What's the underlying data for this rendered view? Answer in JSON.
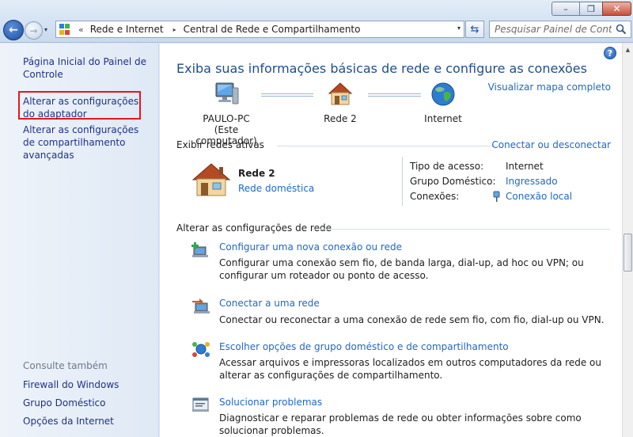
{
  "window": {
    "minimize_glyph": "–",
    "maximize_glyph": "❐",
    "close_glyph": "✕"
  },
  "toolbar": {
    "back_glyph": "←",
    "forward_glyph": "→",
    "recent_glyph": "▾",
    "refresh_glyph": "⇆"
  },
  "address": {
    "chevron": "«",
    "crumbs": [
      "Rede e Internet",
      "Central de Rede e Compartilhamento"
    ],
    "separator": "▸",
    "dropdown_glyph": "▾",
    "icon": "control-panel-icon"
  },
  "search": {
    "placeholder": "Pesquisar Painel de Contr...",
    "icon": "search-icon"
  },
  "sidebar": {
    "links": [
      "Página Inicial do Painel de Controle",
      "Alterar as configurações do adaptador",
      "Alterar as configurações de compartilhamento avançadas"
    ],
    "see_also_label": "Consulte também",
    "see_also": [
      "Firewall do Windows",
      "Grupo Doméstico",
      "Opções da Internet"
    ],
    "highlight_color": "#e4171c"
  },
  "main": {
    "help_glyph": "?",
    "title": "Exiba suas informações básicas de rede e configure as conexões",
    "view_map_link": "Visualizar mapa completo",
    "map": {
      "pc_name": "PAULO-PC",
      "pc_caption": "(Este computador)",
      "network_name": "Rede  2",
      "internet_label": "Internet"
    },
    "active": {
      "heading": "Exibir redes ativas",
      "connect_link": "Conectar ou desconectar",
      "network_name": "Rede  2",
      "network_type": "Rede doméstica",
      "access_label": "Tipo de acesso:",
      "access_value": "Internet",
      "homegroup_label": "Grupo Doméstico:",
      "homegroup_value": "Ingressado",
      "connections_label": "Conexões:",
      "connections_value": "Conexão local"
    },
    "settings": {
      "heading": "Alterar as configurações de rede",
      "tasks": [
        {
          "link": "Configurar uma nova conexão ou rede",
          "desc": "Configurar uma conexão sem fio, de banda larga, dial-up, ad hoc ou VPN; ou configurar um roteador ou ponto de acesso.",
          "icon": "new-connection-icon"
        },
        {
          "link": "Conectar a uma rede",
          "desc": "Conectar ou reconectar a uma conexão de rede sem fio, com fio, dial-up ou VPN.",
          "icon": "connect-network-icon"
        },
        {
          "link": "Escolher opções de grupo doméstico e de compartilhamento",
          "desc": "Acessar arquivos e impressoras localizados em outros computadores da rede ou alterar as configurações de compartilhamento.",
          "icon": "homegroup-icon"
        },
        {
          "link": "Solucionar problemas",
          "desc": "Diagnosticar e reparar problemas de rede ou obter informações sobre como solucionar problemas.",
          "icon": "troubleshoot-icon"
        }
      ]
    }
  },
  "colors": {
    "link": "#1e68c9",
    "nav_link": "#1e3287",
    "title": "#1e4e8c",
    "sidebar_bg": "#e4edf7"
  }
}
